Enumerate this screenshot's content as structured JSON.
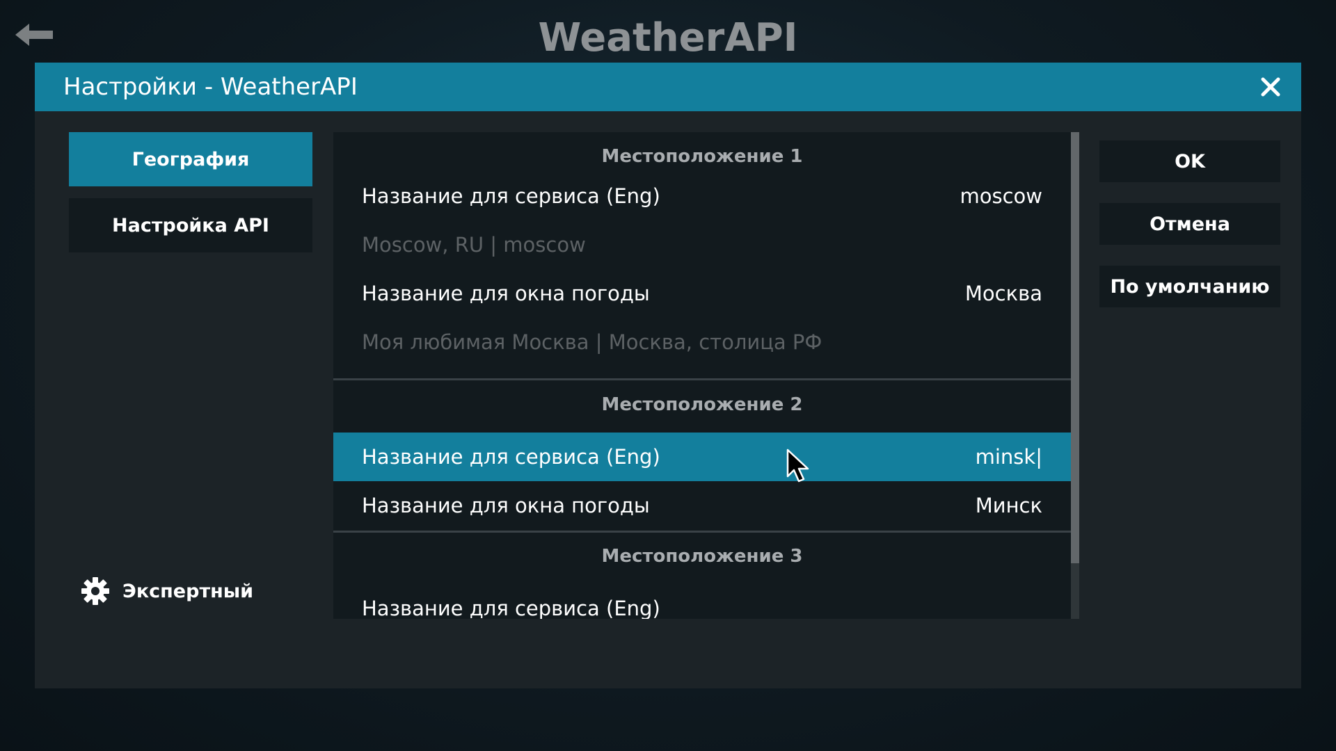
{
  "app": {
    "title": "WeatherAPI"
  },
  "dialog": {
    "title": "Настройки - WeatherAPI"
  },
  "categories": [
    {
      "label": "География",
      "active": true
    },
    {
      "label": "Настройка API",
      "active": false
    }
  ],
  "level": {
    "label": "Экспертный",
    "icon": "gear-icon"
  },
  "sections": [
    {
      "header": "Местоположение 1",
      "rows": [
        {
          "label": "Название для сервиса (Eng)",
          "value": "moscow"
        },
        {
          "hint": "Moscow, RU | moscow"
        },
        {
          "label": "Название для окна погоды",
          "value": "Москва"
        },
        {
          "hint": "Моя любимая Москва | Москва, столица РФ"
        }
      ]
    },
    {
      "header": "Местоположение 2",
      "rows": [
        {
          "label": "Название для сервиса (Eng)",
          "value": "minsk|",
          "selected": true
        },
        {
          "label": "Название для окна погоды",
          "value": "Минск"
        }
      ]
    },
    {
      "header": "Местоположение 3",
      "rows": [
        {
          "label": "Название для сервиса (Eng)",
          "value": ""
        }
      ]
    }
  ],
  "buttons": {
    "ok": "OK",
    "cancel": "Отмена",
    "defaults": "По умолчанию"
  },
  "icons": {
    "back": "back-arrow-icon",
    "close": "close-icon",
    "cursor": "mouse-pointer-icon"
  },
  "colors": {
    "accent": "#137f9d",
    "dialog_bg": "#1c2327",
    "panel_bg": "#121a1e",
    "title_gray": "#8e9295",
    "hint_gray": "#5d6265"
  }
}
